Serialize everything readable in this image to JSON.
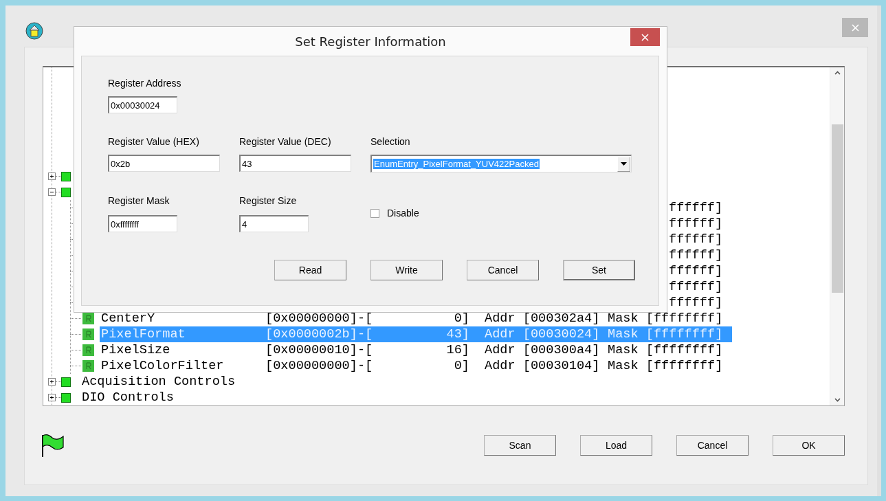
{
  "main_window": {
    "tree": {
      "items": [
        {
          "kind": "group",
          "expanded": false
        },
        {
          "kind": "group",
          "expanded": true,
          "children": [
            {
              "kind": "covered",
              "mask": "ffffff]",
              "selected": false
            },
            {
              "kind": "covered",
              "mask": "ffffff]",
              "selected": false
            },
            {
              "kind": "covered",
              "mask": "ffffff]",
              "selected": false
            },
            {
              "kind": "covered",
              "mask": "ffffff]",
              "selected": false
            },
            {
              "kind": "covered",
              "mask": "ffffff]",
              "selected": false
            },
            {
              "kind": "covered",
              "mask": "ffffff]",
              "selected": false
            },
            {
              "kind": "covered",
              "mask": "ffffff]",
              "selected": false
            },
            {
              "kind": "register",
              "name": "CenterY",
              "value": "[0x00000000]-[",
              "decimal": "0]",
              "address": "Addr [000302a4]",
              "mask": "Mask [ffffffff]",
              "selected": false
            },
            {
              "kind": "register",
              "name": "PixelFormat",
              "value": "[0x0000002b]-[",
              "decimal": "43]",
              "address": "Addr [00030024]",
              "mask": "Mask [ffffffff]",
              "selected": true
            },
            {
              "kind": "register",
              "name": "PixelSize",
              "value": "[0x00000010]-[",
              "decimal": "16]",
              "address": "Addr [000300a4]",
              "mask": "Mask [ffffffff]",
              "selected": false
            },
            {
              "kind": "register",
              "name": "PixelColorFilter",
              "value": "[0x00000000]-[",
              "decimal": "0]",
              "address": "Addr [00030104]",
              "mask": "Mask [ffffffff]",
              "selected": false
            }
          ]
        },
        {
          "kind": "group",
          "label": "Acquisition Controls",
          "expanded": false
        },
        {
          "kind": "group",
          "label": "DIO Controls",
          "expanded": false
        }
      ]
    },
    "buttons": [
      {
        "label": "Scan"
      },
      {
        "label": "Load"
      },
      {
        "label": "Cancel"
      },
      {
        "label": "OK"
      }
    ]
  },
  "dialog": {
    "title": "Set Register Information",
    "address": {
      "label": "Register Address",
      "value": "0x00030024"
    },
    "value_hex": {
      "label": "Register Value (HEX)",
      "value": "0x2b"
    },
    "value_dec": {
      "label": "Register Value (DEC)",
      "value": "43"
    },
    "selection": {
      "label": "Selection",
      "value": "EnumEntry_PixelFormat_YUV422Packed"
    },
    "mask": {
      "label": "Register Mask",
      "value": "0xffffffff"
    },
    "size": {
      "label": "Register Size",
      "value": "4"
    },
    "disable": {
      "label": "Disable",
      "checked": false
    },
    "buttons": [
      {
        "label": "Read",
        "default": false
      },
      {
        "label": "Write",
        "default": false
      },
      {
        "label": "Cancel",
        "default": false
      },
      {
        "label": "Set",
        "default": true
      }
    ]
  }
}
